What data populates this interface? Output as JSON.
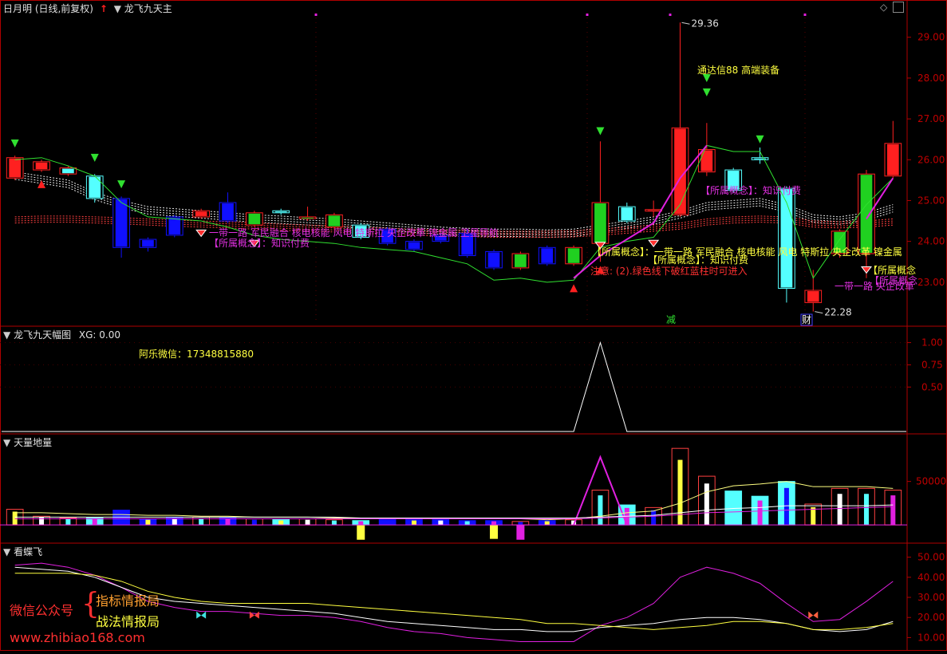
{
  "colors": {
    "bg": "#000000",
    "frame": "#b00000",
    "grid": "#7a0000",
    "axis_text": "#c00000",
    "up": "#ff2020",
    "down_cyan": "#54ffff",
    "down_blue": "#1010ff",
    "green": "#20d020",
    "magenta": "#e020e0",
    "yellow": "#ffff40",
    "white": "#ffffff"
  },
  "panel1": {
    "title": "日月明 (日线,前复权)",
    "indicator": "龙飞九天主",
    "high_label": "29.36",
    "low_label": "22.28",
    "annotations": {
      "tdx": "通达信88 高端装备",
      "concept1": "一带一路 军民融合 核电核能 风电 特斯拉 央企改革 镍金属 卫星导航",
      "concept1_short": "【所属概念】：知识付费",
      "concept2": "【所属概念】：一带一路 军民融合 核电核能 风电 特斯拉 央企改革 镍金属",
      "concept2_short": "【所属概念】：知识付费",
      "note": "注意: (2).绿色线下破红蓝柱时可进入",
      "concept3": "【所属概念】：知识付费",
      "concept4a": "【所属概念",
      "concept4b": "【所属概念",
      "concept4c": "一带一路 央企改革",
      "marker_jian": "减",
      "marker_cai": "财"
    }
  },
  "panel2": {
    "title": "龙飞九天幅图",
    "xg": "XG: 0.00",
    "wechat": "阿乐微信：17348815880"
  },
  "panel3": {
    "title": "天量地量"
  },
  "panel4": {
    "title": "看蝶飞"
  },
  "watermark": {
    "label1": "微信公众号",
    "label2": "指标情报局",
    "label3": "战法情报局",
    "url": "www.zhibiao168.com"
  },
  "chart_data": [
    {
      "type": "candlestick",
      "title": "日月明 (日线,前复权)",
      "ylim": [
        22.0,
        29.6
      ],
      "yticks": [
        "29.00",
        "28.00",
        "27.00",
        "26.00",
        "25.00",
        "24.00",
        "23.00"
      ],
      "tick_values": [
        29,
        28,
        27,
        26,
        25,
        24,
        23
      ],
      "candles": [
        {
          "o": 25.55,
          "c": 26.05,
          "h": 26.1,
          "l": 25.5,
          "k": "up"
        },
        {
          "o": 25.75,
          "c": 25.95,
          "h": 26.0,
          "l": 25.7,
          "k": "up"
        },
        {
          "o": 25.65,
          "c": 25.8,
          "h": 25.85,
          "l": 25.6,
          "k": "upc"
        },
        {
          "o": 25.6,
          "c": 25.05,
          "h": 25.65,
          "l": 24.95,
          "k": "dc"
        },
        {
          "o": 25.05,
          "c": 23.85,
          "h": 25.1,
          "l": 23.6,
          "k": "db"
        },
        {
          "o": 24.05,
          "c": 23.85,
          "h": 24.1,
          "l": 23.75,
          "k": "db"
        },
        {
          "o": 24.6,
          "c": 24.15,
          "h": 24.65,
          "l": 24.1,
          "k": "db"
        },
        {
          "o": 24.6,
          "c": 24.75,
          "h": 24.8,
          "l": 24.55,
          "k": "up"
        },
        {
          "o": 24.95,
          "c": 24.5,
          "h": 25.2,
          "l": 24.45,
          "k": "db"
        },
        {
          "o": 24.4,
          "c": 24.7,
          "h": 24.75,
          "l": 24.35,
          "k": "upg"
        },
        {
          "o": 24.75,
          "c": 24.7,
          "h": 24.8,
          "l": 24.65,
          "k": "dc"
        },
        {
          "o": 24.6,
          "c": 24.6,
          "h": 24.85,
          "l": 24.5,
          "k": "upg"
        },
        {
          "o": 24.65,
          "c": 24.35,
          "h": 24.7,
          "l": 24.3,
          "k": "upg"
        },
        {
          "o": 24.4,
          "c": 24.1,
          "h": 24.45,
          "l": 24.05,
          "k": "dc"
        },
        {
          "o": 24.3,
          "c": 23.95,
          "h": 24.35,
          "l": 23.9,
          "k": "db"
        },
        {
          "o": 24.0,
          "c": 23.8,
          "h": 24.05,
          "l": 23.75,
          "k": "db"
        },
        {
          "o": 24.15,
          "c": 24.0,
          "h": 24.2,
          "l": 23.95,
          "k": "db"
        },
        {
          "o": 24.2,
          "c": 23.65,
          "h": 24.3,
          "l": 23.6,
          "k": "db"
        },
        {
          "o": 23.75,
          "c": 23.35,
          "h": 23.8,
          "l": 23.3,
          "k": "db"
        },
        {
          "o": 23.35,
          "c": 23.7,
          "h": 23.75,
          "l": 23.3,
          "k": "upg"
        },
        {
          "o": 23.85,
          "c": 23.45,
          "h": 23.9,
          "l": 23.4,
          "k": "db"
        },
        {
          "o": 23.45,
          "c": 23.85,
          "h": 23.9,
          "l": 23.4,
          "k": "upg"
        },
        {
          "o": 23.95,
          "c": 24.95,
          "h": 26.45,
          "l": 23.5,
          "k": "upg"
        },
        {
          "o": 24.85,
          "c": 24.5,
          "h": 24.95,
          "l": 24.45,
          "k": "dc"
        },
        {
          "o": 24.75,
          "c": 24.78,
          "h": 25.0,
          "l": 24.6,
          "k": "up"
        },
        {
          "o": 24.65,
          "c": 26.78,
          "h": 29.36,
          "l": 24.6,
          "k": "up"
        },
        {
          "o": 25.7,
          "c": 26.25,
          "h": 26.9,
          "l": 25.6,
          "k": "up"
        },
        {
          "o": 25.75,
          "c": 25.25,
          "h": 25.8,
          "l": 25.2,
          "k": "dc"
        },
        {
          "o": 26.0,
          "c": 26.05,
          "h": 26.3,
          "l": 25.9,
          "k": "dc"
        },
        {
          "o": 25.3,
          "c": 22.85,
          "h": 25.35,
          "l": 22.5,
          "k": "dc"
        },
        {
          "o": 22.5,
          "c": 22.8,
          "h": 23.3,
          "l": 22.28,
          "k": "up"
        },
        {
          "o": 23.7,
          "c": 24.25,
          "h": 24.3,
          "l": 23.6,
          "k": "upg"
        },
        {
          "o": 23.7,
          "c": 25.65,
          "h": 25.75,
          "l": 23.1,
          "k": "upg"
        },
        {
          "o": 25.6,
          "c": 26.4,
          "h": 26.95,
          "l": 25.55,
          "k": "up"
        }
      ],
      "green_line": [
        26.0,
        26.05,
        25.85,
        25.6,
        24.95,
        24.6,
        24.55,
        24.5,
        24.35,
        24.15,
        24.05,
        24.0,
        23.95,
        23.85,
        23.8,
        23.75,
        23.6,
        23.45,
        23.05,
        23.1,
        23.0,
        23.05,
        23.85,
        24.0,
        24.1,
        24.9,
        26.35,
        26.2,
        26.2,
        24.95,
        23.1,
        24.05,
        24.9,
        25.55
      ],
      "magenta_line": [
        null,
        null,
        null,
        null,
        null,
        null,
        null,
        null,
        null,
        null,
        null,
        null,
        null,
        null,
        null,
        null,
        null,
        null,
        null,
        null,
        null,
        23.1,
        23.65,
        24.05,
        24.45,
        25.55,
        26.35,
        null,
        null,
        null,
        null,
        null,
        24.55,
        25.55
      ],
      "white_band": [
        25.7,
        25.6,
        25.5,
        25.2,
        25.0,
        24.85,
        24.8,
        24.75,
        24.7,
        24.65,
        24.62,
        24.58,
        24.55,
        24.5,
        24.45,
        24.4,
        24.35,
        24.32,
        24.3,
        24.3,
        24.28,
        24.3,
        24.4,
        24.5,
        24.6,
        24.75,
        24.95,
        25.0,
        25.05,
        24.9,
        24.65,
        24.6,
        24.7,
        24.9
      ],
      "red_band": [
        24.6,
        24.62,
        24.62,
        24.6,
        24.58,
        24.55,
        24.52,
        24.5,
        24.48,
        24.45,
        24.42,
        24.4,
        24.38,
        24.35,
        24.32,
        24.3,
        24.28,
        24.27,
        24.25,
        24.25,
        24.25,
        24.26,
        24.3,
        24.35,
        24.4,
        24.45,
        24.55,
        24.6,
        24.62,
        24.6,
        24.5,
        24.48,
        24.5,
        24.55
      ]
    },
    {
      "type": "line",
      "title": "龙飞九天幅图",
      "ylim": [
        0,
        1.05
      ],
      "yticks": [
        "1.00",
        "0.75",
        "0.50"
      ],
      "tick_values": [
        1.0,
        0.75,
        0.5
      ],
      "values": [
        0,
        0,
        0,
        0,
        0,
        0,
        0,
        0,
        0,
        0,
        0,
        0,
        0,
        0,
        0,
        0,
        0,
        0,
        0,
        0,
        0,
        0,
        1,
        0,
        0,
        0,
        0,
        0,
        0,
        0,
        0,
        0,
        0,
        0
      ]
    },
    {
      "type": "bar",
      "title": "天量地量",
      "ylim": [
        -20000,
        90000
      ],
      "yticks": [
        "50000"
      ],
      "tick_values": [
        50000
      ],
      "volumes": [
        18000,
        10000,
        8000,
        8000,
        17000,
        7000,
        9000,
        9000,
        8000,
        7000,
        6000,
        7000,
        6000,
        5000,
        6000,
        6000,
        6000,
        5000,
        5000,
        4000,
        5000,
        6000,
        40000,
        23000,
        20000,
        88000,
        56000,
        39000,
        33000,
        50000,
        24000,
        42000,
        42000,
        40000
      ],
      "markers": [
        0,
        0,
        0,
        0,
        0,
        0,
        0,
        0,
        0,
        0,
        0,
        0,
        0,
        -17000,
        0,
        0,
        0,
        0,
        -16000,
        -17000,
        0,
        0,
        0,
        0,
        0,
        0,
        0,
        0,
        0,
        0,
        0,
        0,
        0,
        0
      ],
      "triangle_peak": 78000,
      "line_yellow": [
        14000,
        14000,
        13000,
        12000,
        12000,
        11000,
        11000,
        10000,
        10000,
        9000,
        9000,
        9000,
        8000,
        8000,
        8000,
        7000,
        7000,
        7000,
        7000,
        7000,
        6000,
        7000,
        10000,
        14000,
        16000,
        25000,
        38000,
        45000,
        47000,
        50000,
        44000,
        44000,
        44000,
        42000
      ],
      "line_white": [
        9000,
        9000,
        9000,
        9000,
        9000,
        9000,
        9000,
        9000,
        9000,
        9000,
        9000,
        9000,
        9000,
        8000,
        8000,
        8000,
        8000,
        8000,
        8000,
        8000,
        8000,
        8000,
        9000,
        10000,
        11000,
        14000,
        17000,
        19000,
        20000,
        22000,
        22000,
        22000,
        22000,
        23000
      ],
      "line_magenta": [
        7000,
        7000,
        7000,
        7000,
        7000,
        7000,
        7000,
        7000,
        7000,
        7000,
        7000,
        7000,
        7000,
        7000,
        7000,
        7000,
        7000,
        7000,
        7000,
        7000,
        7000,
        7000,
        8000,
        9000,
        10000,
        12000,
        14000,
        15000,
        16000,
        17000,
        18000,
        19000,
        20000,
        21000
      ]
    },
    {
      "type": "line",
      "title": "看蝶飞",
      "ylim": [
        5,
        55
      ],
      "yticks": [
        "50.00",
        "40.00",
        "30.00",
        "20.00",
        "10.00"
      ],
      "tick_values": [
        50,
        40,
        30,
        20,
        10
      ],
      "series": [
        {
          "name": "",
          "color": "#e020e0",
          "values": [
            46,
            47,
            45,
            41,
            35,
            28,
            25,
            23,
            23,
            22,
            21,
            21,
            20,
            18,
            15,
            13,
            12,
            10,
            9,
            8,
            8,
            8,
            16,
            20,
            27,
            40,
            45,
            42,
            37,
            27,
            18,
            19,
            28,
            38
          ]
        },
        {
          "name": "",
          "color": "#ffffff",
          "values": [
            45,
            44,
            43,
            40,
            35,
            30,
            28,
            27,
            26,
            25,
            24,
            23,
            22,
            20,
            18,
            17,
            16,
            15,
            14,
            14,
            13,
            13,
            15,
            16,
            17,
            19,
            20,
            20,
            19,
            17,
            14,
            13,
            14,
            18
          ]
        },
        {
          "name": "",
          "color": "#ffff40",
          "values": [
            42,
            42,
            42,
            41,
            38,
            33,
            30,
            28,
            27,
            27,
            27,
            27,
            26,
            25,
            24,
            23,
            22,
            21,
            20,
            19,
            17,
            17,
            16,
            15,
            14,
            15,
            16,
            18,
            18,
            17,
            14,
            14,
            15,
            17
          ]
        }
      ]
    }
  ]
}
